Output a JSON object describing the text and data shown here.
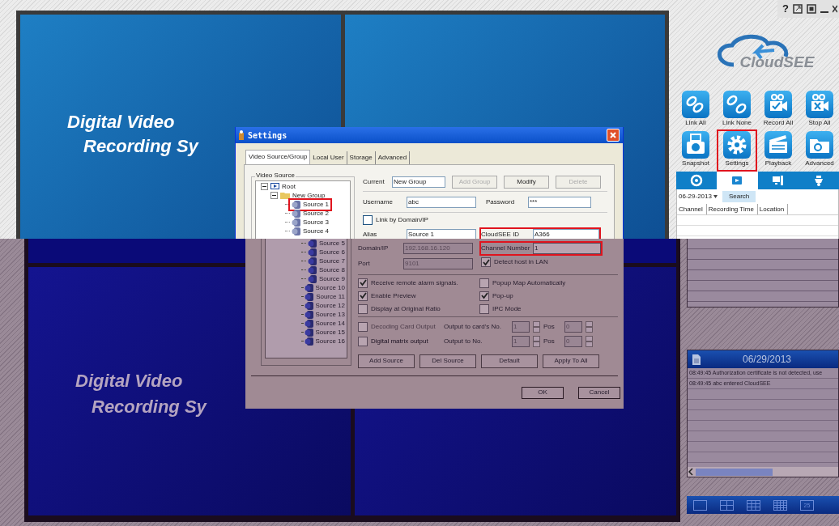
{
  "window_controls": {
    "help": "?"
  },
  "video_top": {
    "line1": "Digital Video",
    "line2": "Recording Sy"
  },
  "video_bottom": {
    "line1": "Digital Video",
    "line2": "Recording Sy"
  },
  "settings": {
    "title": "Settings",
    "tabs": [
      {
        "label": "Video Source/Group",
        "selected": true
      },
      {
        "label": "Local User",
        "selected": false
      },
      {
        "label": "Storage",
        "selected": false
      },
      {
        "label": "Advanced",
        "selected": false
      }
    ],
    "group_label": "Video Source",
    "tree": [
      {
        "label": "Root",
        "kind": "root",
        "expanded": true,
        "children": [
          {
            "label": "New Group",
            "kind": "folder",
            "expanded": true,
            "children": [
              {
                "label": "Source 1",
                "highlighted": true
              },
              {
                "label": "Source 2",
                "highlighted": false
              },
              {
                "label": "Source 3",
                "highlighted": false
              },
              {
                "label": "Source 4",
                "highlighted": false
              },
              {
                "label": "Source 5",
                "highlighted": false
              },
              {
                "label": "Source 6",
                "highlighted": false
              },
              {
                "label": "Source 7",
                "highlighted": false
              },
              {
                "label": "Source 8",
                "highlighted": false
              },
              {
                "label": "Source 9",
                "highlighted": false
              },
              {
                "label": "Source 10",
                "highlighted": false
              },
              {
                "label": "Source 11",
                "highlighted": false
              },
              {
                "label": "Source 12",
                "highlighted": false
              },
              {
                "label": "Source 13",
                "highlighted": false
              },
              {
                "label": "Source 14",
                "highlighted": false
              },
              {
                "label": "Source 15",
                "highlighted": false
              },
              {
                "label": "Source 16",
                "highlighted": false
              }
            ]
          }
        ]
      }
    ],
    "current": {
      "label": "Current",
      "value": "New Group"
    },
    "group_buttons": [
      {
        "label": "Add Group",
        "disabled": true
      },
      {
        "label": "Modify",
        "disabled": false
      },
      {
        "label": "Delete",
        "disabled": true
      }
    ],
    "username": {
      "label": "Username",
      "value": "abc"
    },
    "password": {
      "label": "Password",
      "value": "***"
    },
    "link_by_domain": {
      "label": "Link by Domain/IP",
      "checked": false
    },
    "alias": {
      "label": "Alias",
      "value": "Source 1"
    },
    "cloudsee_id": {
      "label": "CloudSEE ID",
      "value": "A366",
      "highlighted": true
    },
    "domain_ip": {
      "label": "Domain/IP",
      "value": "192.168.16.120",
      "disabled": true
    },
    "port": {
      "label": "Port",
      "value": "9101",
      "disabled": true
    },
    "channel_number": {
      "label": "Channel Number",
      "value": "1",
      "highlighted": true
    },
    "detect_host": {
      "label": "Detect host in LAN",
      "checked": true
    },
    "options": [
      {
        "label": "Receive remote alarm signals.",
        "checked": true
      },
      {
        "label": "Popup Map Automatically",
        "checked": false
      },
      {
        "label": "Enable Preview",
        "checked": true
      },
      {
        "label": "Pop-up",
        "checked": true
      },
      {
        "label": "Display at Original Ratio",
        "checked": false
      },
      {
        "label": "IPC Mode",
        "checked": false
      }
    ],
    "outputs": [
      {
        "label": "Decoding Card Output",
        "checked": false,
        "disabled": true,
        "output_label": "Output to card's No.",
        "output_value": "1",
        "pos_label": "Pos",
        "pos_value": "0"
      },
      {
        "label": "Digital matrix output",
        "checked": false,
        "disabled": false,
        "output_label": "Output to No.",
        "output_value": "1",
        "pos_label": "Pos",
        "pos_value": "0"
      }
    ],
    "source_buttons": [
      "Add Source",
      "Del Source",
      "Default",
      "Apply To All"
    ],
    "dialog_buttons": [
      "OK",
      "Cancel"
    ]
  },
  "logo": {
    "text": "CloudSEE"
  },
  "toolbar_buttons": [
    {
      "label": "Link All",
      "kind": "link",
      "highlighted": false
    },
    {
      "label": "Link None",
      "kind": "unlink",
      "highlighted": false
    },
    {
      "label": "Record All",
      "kind": "record",
      "highlighted": false
    },
    {
      "label": "Stop All",
      "kind": "stop",
      "highlighted": false
    },
    {
      "label": "Snapshot",
      "kind": "snapshot",
      "highlighted": false
    },
    {
      "label": "Settings",
      "kind": "settings",
      "highlighted": true
    },
    {
      "label": "Playback",
      "kind": "playback",
      "highlighted": false
    },
    {
      "label": "Advanced",
      "kind": "advanced",
      "highlighted": false
    }
  ],
  "panel_tabs": [
    {
      "kind": "browser",
      "selected": false
    },
    {
      "kind": "playback",
      "selected": true
    },
    {
      "kind": "monitor",
      "selected": false
    },
    {
      "kind": "ptz",
      "selected": false
    }
  ],
  "record_search": {
    "date": "06-29-2013",
    "button": "Search",
    "columns": [
      "Channel",
      "Recording Time",
      "Location"
    ]
  },
  "log": {
    "date": "06/29/2013",
    "entries": [
      "08:49:45 Authorization certificate is not detected, use",
      "08:49:45 abc entered CloudSEE"
    ]
  },
  "layouts": [
    {
      "kind": "single"
    },
    {
      "kind": "quad"
    },
    {
      "kind": "nine"
    },
    {
      "kind": "sixteen"
    },
    {
      "kind": "custom",
      "label": "25"
    }
  ]
}
